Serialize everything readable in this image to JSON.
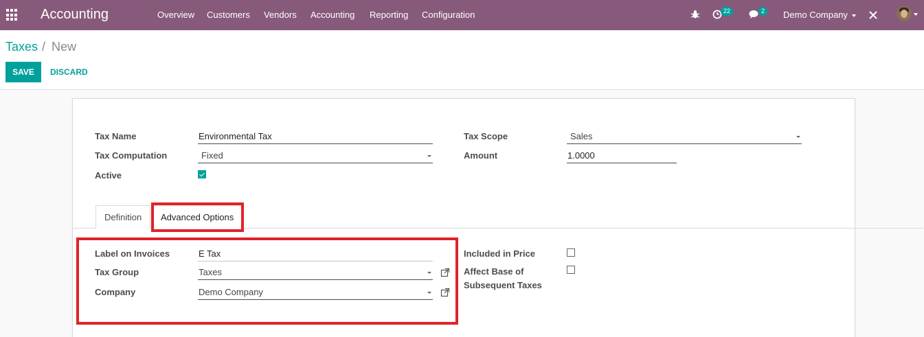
{
  "navbar": {
    "brand": "Accounting",
    "menu": [
      "Overview",
      "Customers",
      "Vendors",
      "Accounting",
      "Reporting",
      "Configuration"
    ],
    "activity_count": "22",
    "message_count": "2",
    "company": "Demo Company",
    "brand_color": "#875a7b"
  },
  "breadcrumb": {
    "parent": "Taxes",
    "separator": "/",
    "current": "New"
  },
  "buttons": {
    "save": "SAVE",
    "discard": "DISCARD",
    "accent": "#00a09d"
  },
  "form": {
    "tax_name_label": "Tax Name",
    "tax_name_value": "Environmental Tax",
    "tax_computation_label": "Tax Computation",
    "tax_computation_value": "Fixed",
    "active_label": "Active",
    "active_checked": true,
    "tax_scope_label": "Tax Scope",
    "tax_scope_value": "Sales",
    "amount_label": "Amount",
    "amount_value": "1.0000"
  },
  "tabs": [
    {
      "label": "Definition",
      "active": false
    },
    {
      "label": "Advanced Options",
      "active": true
    }
  ],
  "advanced": {
    "label_on_invoices_label": "Label on Invoices",
    "label_on_invoices_value": "E Tax",
    "tax_group_label": "Tax Group",
    "tax_group_value": "Taxes",
    "company_label": "Company",
    "company_value": "Demo Company",
    "included_in_price_label": "Included in Price",
    "included_in_price_checked": false,
    "affect_base_label_line1": "Affect Base of",
    "affect_base_label_line2": "Subsequent Taxes",
    "affect_base_checked": false
  },
  "highlight_color": "#e0232a"
}
